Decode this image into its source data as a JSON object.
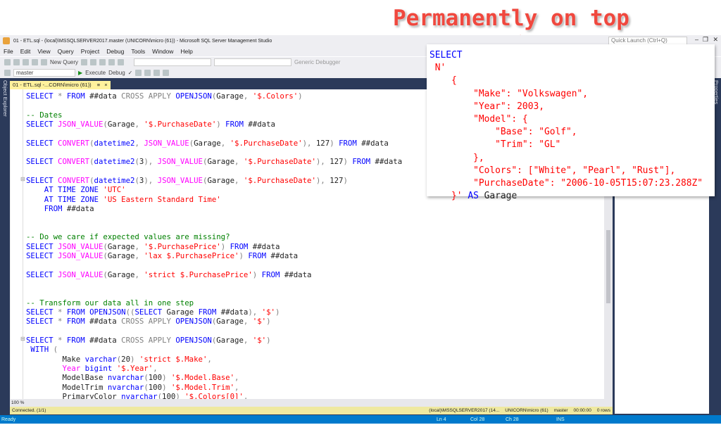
{
  "annotation": "Permanently on top",
  "window": {
    "title": "01 - ETL.sql - (local)\\MSSQLSERVER2017.master (UNICORN\\micro (61)) - Microsoft SQL Server Management Studio",
    "quick_launch": "Quick Launch (Ctrl+Q)"
  },
  "menu": [
    "File",
    "Edit",
    "View",
    "Query",
    "Project",
    "Debug",
    "Tools",
    "Window",
    "Help"
  ],
  "toolbar": {
    "new_query": "New Query",
    "debugger": "Generic Debugger",
    "database": "master",
    "execute": "Execute",
    "debug": "Debug"
  },
  "side": {
    "object_explorer": "Object Explorer",
    "properties": "Properties"
  },
  "tab": {
    "label": "01 - ETL.sql -...CORN\\micro (61))",
    "pin": "≡",
    "close": "×"
  },
  "code": [
    [
      [
        "k",
        "SELECT"
      ],
      [
        "o",
        " * "
      ],
      [
        "k",
        "FROM"
      ],
      [
        "t",
        " ##data "
      ],
      [
        "o",
        "CROSS APPLY "
      ],
      [
        "k",
        "OPENJSON"
      ],
      [
        "o",
        "("
      ],
      [
        "t",
        "Garage"
      ],
      [
        "o",
        ", "
      ],
      [
        "s",
        "'$.Colors'"
      ],
      [
        "o",
        ")"
      ]
    ],
    [],
    [
      [
        "c",
        "-- Dates"
      ]
    ],
    [
      [
        "k",
        "SELECT "
      ],
      [
        "f",
        "JSON_VALUE"
      ],
      [
        "o",
        "("
      ],
      [
        "t",
        "Garage"
      ],
      [
        "o",
        ", "
      ],
      [
        "s",
        "'$.PurchaseDate'"
      ],
      [
        "o",
        ") "
      ],
      [
        "k",
        "FROM"
      ],
      [
        "t",
        " ##data"
      ]
    ],
    [],
    [
      [
        "k",
        "SELECT "
      ],
      [
        "f",
        "CONVERT"
      ],
      [
        "o",
        "("
      ],
      [
        "k",
        "datetime2"
      ],
      [
        "o",
        ", "
      ],
      [
        "f",
        "JSON_VALUE"
      ],
      [
        "o",
        "("
      ],
      [
        "t",
        "Garage"
      ],
      [
        "o",
        ", "
      ],
      [
        "s",
        "'$.PurchaseDate'"
      ],
      [
        "o",
        "), "
      ],
      [
        "t",
        "127"
      ],
      [
        "o",
        ") "
      ],
      [
        "k",
        "FROM"
      ],
      [
        "t",
        " ##data"
      ]
    ],
    [],
    [
      [
        "k",
        "SELECT "
      ],
      [
        "f",
        "CONVERT"
      ],
      [
        "o",
        "("
      ],
      [
        "k",
        "datetime2"
      ],
      [
        "o",
        "("
      ],
      [
        "t",
        "3"
      ],
      [
        "o",
        "), "
      ],
      [
        "f",
        "JSON_VALUE"
      ],
      [
        "o",
        "("
      ],
      [
        "t",
        "Garage"
      ],
      [
        "o",
        ", "
      ],
      [
        "s",
        "'$.PurchaseDate'"
      ],
      [
        "o",
        "), "
      ],
      [
        "t",
        "127"
      ],
      [
        "o",
        ") "
      ],
      [
        "k",
        "FROM"
      ],
      [
        "t",
        " ##data"
      ]
    ],
    [],
    [
      [
        "k",
        "SELECT "
      ],
      [
        "f",
        "CONVERT"
      ],
      [
        "o",
        "("
      ],
      [
        "k",
        "datetime2"
      ],
      [
        "o",
        "("
      ],
      [
        "t",
        "3"
      ],
      [
        "o",
        "), "
      ],
      [
        "f",
        "JSON_VALUE"
      ],
      [
        "o",
        "("
      ],
      [
        "t",
        "Garage"
      ],
      [
        "o",
        ", "
      ],
      [
        "s",
        "'$.PurchaseDate'"
      ],
      [
        "o",
        "), "
      ],
      [
        "t",
        "127"
      ],
      [
        "o",
        ")"
      ]
    ],
    [
      [
        "k",
        "    AT TIME ZONE "
      ],
      [
        "s",
        "'UTC'"
      ]
    ],
    [
      [
        "k",
        "    AT TIME ZONE "
      ],
      [
        "s",
        "'US Eastern Standard Time'"
      ]
    ],
    [
      [
        "k",
        "    FROM"
      ],
      [
        "t",
        " ##data"
      ]
    ],
    [],
    [],
    [
      [
        "c",
        "-- Do we care if expected values are missing?"
      ]
    ],
    [
      [
        "k",
        "SELECT "
      ],
      [
        "f",
        "JSON_VALUE"
      ],
      [
        "o",
        "("
      ],
      [
        "t",
        "Garage"
      ],
      [
        "o",
        ", "
      ],
      [
        "s",
        "'$.PurchasePrice'"
      ],
      [
        "o",
        ") "
      ],
      [
        "k",
        "FROM"
      ],
      [
        "t",
        " ##data"
      ]
    ],
    [
      [
        "k",
        "SELECT "
      ],
      [
        "f",
        "JSON_VALUE"
      ],
      [
        "o",
        "("
      ],
      [
        "t",
        "Garage"
      ],
      [
        "o",
        ", "
      ],
      [
        "s",
        "'lax $.PurchasePrice'"
      ],
      [
        "o",
        ") "
      ],
      [
        "k",
        "FROM"
      ],
      [
        "t",
        " ##data"
      ]
    ],
    [],
    [
      [
        "k",
        "SELECT "
      ],
      [
        "f",
        "JSON_VALUE"
      ],
      [
        "o",
        "("
      ],
      [
        "t",
        "Garage"
      ],
      [
        "o",
        ", "
      ],
      [
        "s",
        "'strict $.PurchasePrice'"
      ],
      [
        "o",
        ") "
      ],
      [
        "k",
        "FROM"
      ],
      [
        "t",
        " ##data"
      ]
    ],
    [],
    [],
    [
      [
        "c",
        "-- Transform our data all in one step"
      ]
    ],
    [
      [
        "k",
        "SELECT"
      ],
      [
        "o",
        " * "
      ],
      [
        "k",
        "FROM "
      ],
      [
        "k",
        "OPENJSON"
      ],
      [
        "o",
        "(("
      ],
      [
        "k",
        "SELECT "
      ],
      [
        "t",
        "Garage "
      ],
      [
        "k",
        "FROM"
      ],
      [
        "t",
        " ##data"
      ],
      [
        "o",
        "), "
      ],
      [
        "s",
        "'$'"
      ],
      [
        "o",
        ")"
      ]
    ],
    [
      [
        "k",
        "SELECT"
      ],
      [
        "o",
        " * "
      ],
      [
        "k",
        "FROM"
      ],
      [
        "t",
        " ##data "
      ],
      [
        "o",
        "CROSS APPLY "
      ],
      [
        "k",
        "OPENJSON"
      ],
      [
        "o",
        "("
      ],
      [
        "t",
        "Garage"
      ],
      [
        "o",
        ", "
      ],
      [
        "s",
        "'$'"
      ],
      [
        "o",
        ")"
      ]
    ],
    [],
    [
      [
        "k",
        "SELECT"
      ],
      [
        "o",
        " * "
      ],
      [
        "k",
        "FROM"
      ],
      [
        "t",
        " ##data "
      ],
      [
        "o",
        "CROSS APPLY "
      ],
      [
        "k",
        "OPENJSON"
      ],
      [
        "o",
        "("
      ],
      [
        "t",
        "Garage"
      ],
      [
        "o",
        ", "
      ],
      [
        "s",
        "'$'"
      ],
      [
        "o",
        ")"
      ]
    ],
    [
      [
        "k",
        " WITH "
      ],
      [
        "o",
        "("
      ]
    ],
    [
      [
        "t",
        "        Make "
      ],
      [
        "k",
        "varchar"
      ],
      [
        "o",
        "("
      ],
      [
        "t",
        "20"
      ],
      [
        "o",
        ") "
      ],
      [
        "s",
        "'strict $.Make'"
      ],
      [
        "o",
        ","
      ]
    ],
    [
      [
        "f",
        "        Year "
      ],
      [
        "k",
        "bigint "
      ],
      [
        "s",
        "'$.Year'"
      ],
      [
        "o",
        ","
      ]
    ],
    [
      [
        "t",
        "        ModelBase "
      ],
      [
        "k",
        "nvarchar"
      ],
      [
        "o",
        "("
      ],
      [
        "t",
        "100"
      ],
      [
        "o",
        ") "
      ],
      [
        "s",
        "'$.Model.Base'"
      ],
      [
        "o",
        ","
      ]
    ],
    [
      [
        "t",
        "        ModelTrim "
      ],
      [
        "k",
        "nvarchar"
      ],
      [
        "o",
        "("
      ],
      [
        "t",
        "100"
      ],
      [
        "o",
        ") "
      ],
      [
        "s",
        "'$.Model.Trim'"
      ],
      [
        "o",
        ","
      ]
    ],
    [
      [
        "t",
        "        PrimaryColor "
      ],
      [
        "k",
        "nvarchar"
      ],
      [
        "o",
        "("
      ],
      [
        "t",
        "100"
      ],
      [
        "o",
        ") "
      ],
      [
        "s",
        "'$.Colors[0]'"
      ],
      [
        "o",
        ","
      ]
    ]
  ],
  "popup": [
    [
      [
        "k",
        "SELECT"
      ]
    ],
    [
      [
        "s",
        " N'"
      ]
    ],
    [
      [
        "s",
        "    {"
      ]
    ],
    [
      [
        "s",
        "        \"Make\": \"Volkswagen\","
      ]
    ],
    [
      [
        "s",
        "        \"Year\": 2003,"
      ]
    ],
    [
      [
        "s",
        "        \"Model\": {"
      ]
    ],
    [
      [
        "s",
        "            \"Base\": \"Golf\","
      ]
    ],
    [
      [
        "s",
        "            \"Trim\": \"GL\""
      ]
    ],
    [
      [
        "s",
        "        },"
      ]
    ],
    [
      [
        "s",
        "        \"Colors\": [\"White\", \"Pearl\", \"Rust\"],"
      ]
    ],
    [
      [
        "s",
        "        \"PurchaseDate\": \"2006-10-05T15:07:23.288Z\""
      ]
    ],
    [
      [
        "s",
        "    }'"
      ],
      [
        "k",
        " AS"
      ],
      [
        "t",
        " Garage"
      ]
    ]
  ],
  "zoom": "100 %",
  "status": {
    "connected": "Connected. (1/1)",
    "server": "(local)\\MSSQLSERVER2017 (14...",
    "user": "UNICORN\\micro (61)",
    "db": "master",
    "time": "00:00:00",
    "rows": "0 rows"
  },
  "bottom": {
    "ready": "Ready",
    "ln": "Ln 4",
    "col": "Col 28",
    "ch": "Ch 28",
    "ins": "INS"
  }
}
